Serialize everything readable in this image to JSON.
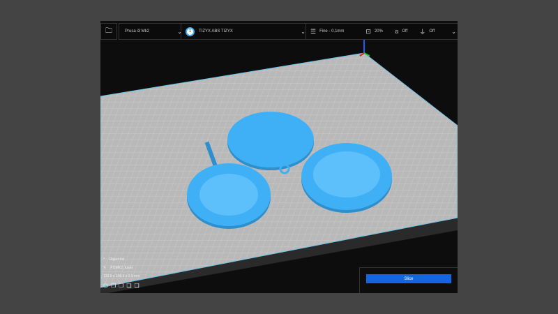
{
  "toolbar": {
    "printer": "Prusa i3 Mk2",
    "material_index": "1",
    "material": "TIZYX ABS TIZYX",
    "profile": "Fine - 0.1mm",
    "infill": "20%",
    "support": "Off",
    "adhesion": "Off"
  },
  "info": {
    "object_list": "Object list",
    "file_name": "PI3MK2_fusee",
    "dimensions": "133.9 x 109.9 x 3.9 mm"
  },
  "slice_label": "Slice",
  "colors": {
    "model": "#3fb0f5",
    "accent": "#1565e0",
    "plate": "#b8b8b8"
  }
}
